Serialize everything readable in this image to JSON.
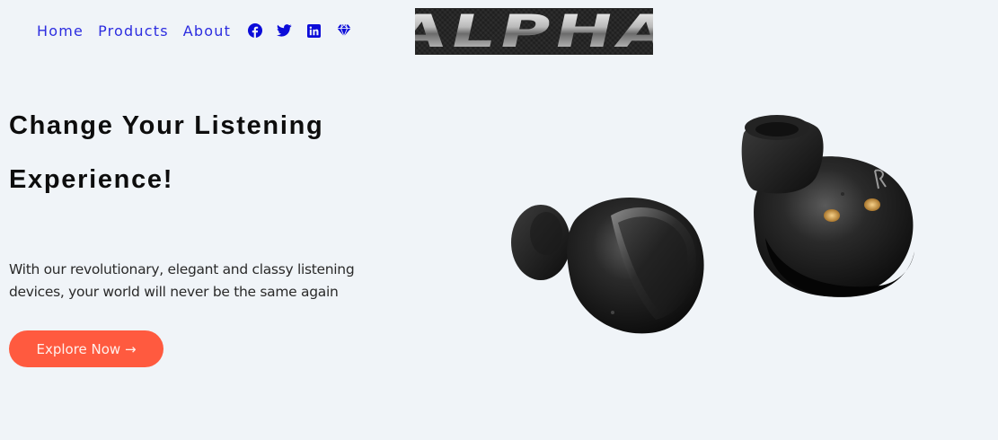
{
  "nav": {
    "links": [
      "Home",
      "Products",
      "About"
    ],
    "icons": [
      "facebook-icon",
      "twitter-icon",
      "linkedin-icon",
      "diamond-icon"
    ]
  },
  "logo": {
    "text": "ALPHA"
  },
  "hero": {
    "title": "Change Your Listening Experience!",
    "subtitle": "With our revolutionary, elegant and classy listening devices, your world will never be the same again",
    "cta_label": "Explore Now →"
  },
  "colors": {
    "background": "#f0f4f8",
    "nav_link": "#2d2de0",
    "icon": "#0c0cd9",
    "cta": "#ff5a3f",
    "heading": "#0d0d0d"
  }
}
